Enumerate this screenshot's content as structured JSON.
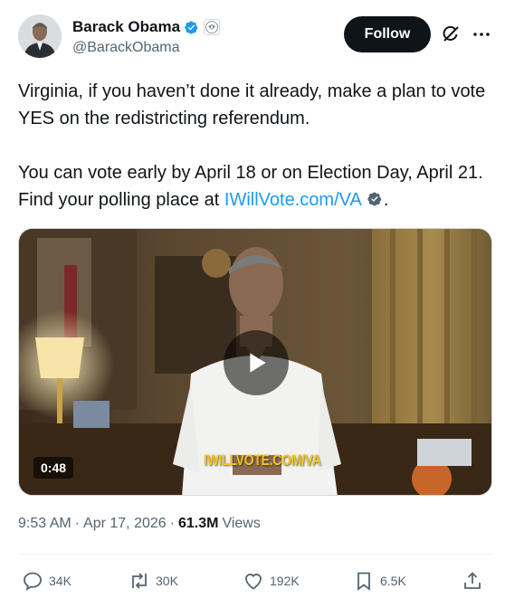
{
  "author": {
    "display_name": "Barack Obama",
    "handle": "@BarackObama",
    "avatar_icon": "profile-photo",
    "verified_icon": "verified-badge-icon",
    "affiliation_icon": "us-seal-icon"
  },
  "header": {
    "follow_label": "Follow",
    "grok_icon": "grok-icon",
    "more_icon": "more-options-icon"
  },
  "tweet": {
    "paragraph1": "Virginia, if you haven’t done it already, make a plan to vote YES on the redistricting referendum.",
    "paragraph2_prefix": "You can vote early by April 18 or on Election Day, April 21. Find your polling place at ",
    "link_text": "IWillVote.com/VA",
    "paragraph2_suffix": "."
  },
  "media": {
    "duration": "0:48",
    "overlay_text": "IWILLVOTE.COM/VA",
    "play_icon": "play-icon"
  },
  "meta": {
    "time": "9:53 AM",
    "separator": "·",
    "date": "Apr 17, 2026",
    "views_count": "61.3M",
    "views_label": "Views"
  },
  "actions": {
    "replies": "34K",
    "reposts": "30K",
    "likes": "192K",
    "bookmarks": "6.5K"
  },
  "colors": {
    "accent": "#1d9bf0",
    "text": "#0f1419",
    "secondary": "#536471",
    "verified_badge": "#1d9bf0",
    "link_badge": "#00ba7c"
  }
}
